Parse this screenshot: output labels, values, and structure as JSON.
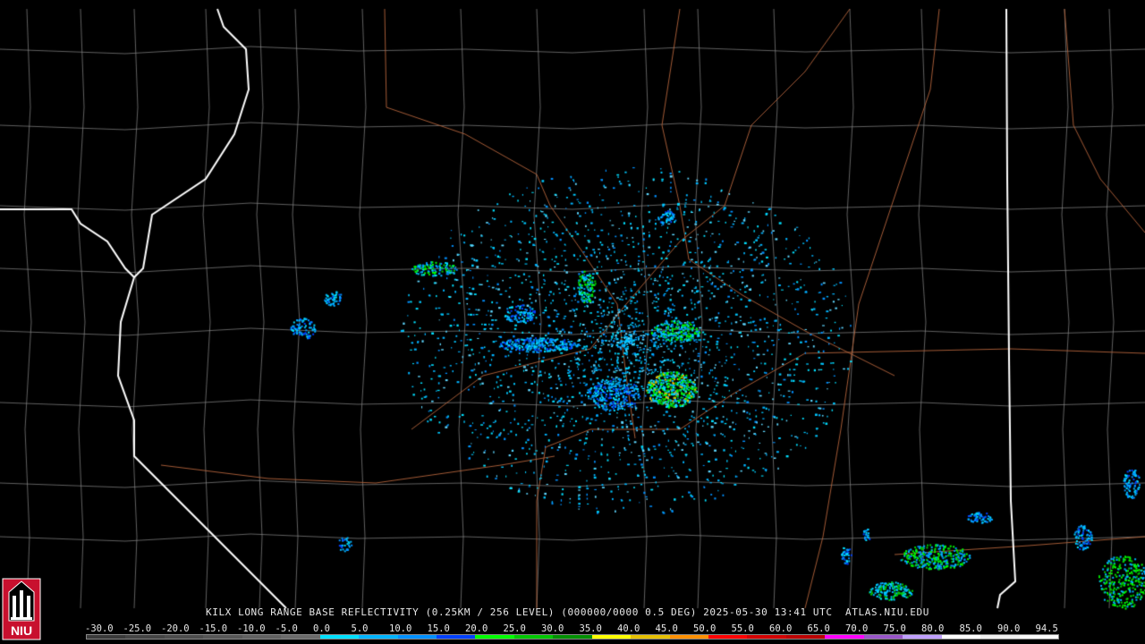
{
  "caption": "KILX LONG RANGE BASE REFLECTIVITY (0.25KM / 256 LEVEL) (000000/0000 0.5 DEG) 2025-05-30 13:41 UTC  ATLAS.NIU.EDU",
  "logo_text": "NIU",
  "scale": {
    "labels": [
      "-30.0",
      "-25.0",
      "-20.0",
      "-15.0",
      "-10.0",
      "-5.0",
      "0.0",
      "5.0",
      "10.0",
      "15.0",
      "20.0",
      "25.0",
      "30.0",
      "35.0",
      "40.0",
      "45.0",
      "50.0",
      "55.0",
      "60.0",
      "65.0",
      "70.0",
      "75.0",
      "80.0",
      "85.0",
      "90.0",
      "94.5"
    ],
    "colors": [
      "#3a3a3a",
      "#444",
      "#4d4d4d",
      "#575757",
      "#616161",
      "#6b6b6b",
      "#00e0ff",
      "#00b4ff",
      "#0090ff",
      "#0040ff",
      "#00ff00",
      "#00c800",
      "#009000",
      "#ffff00",
      "#e6c000",
      "#ff9000",
      "#ff0000",
      "#d40000",
      "#bc0000",
      "#ff00ff",
      "#9955c9",
      "#c0a0ff",
      "#ffffff",
      "#f0f0f0",
      "#fafafa"
    ]
  }
}
